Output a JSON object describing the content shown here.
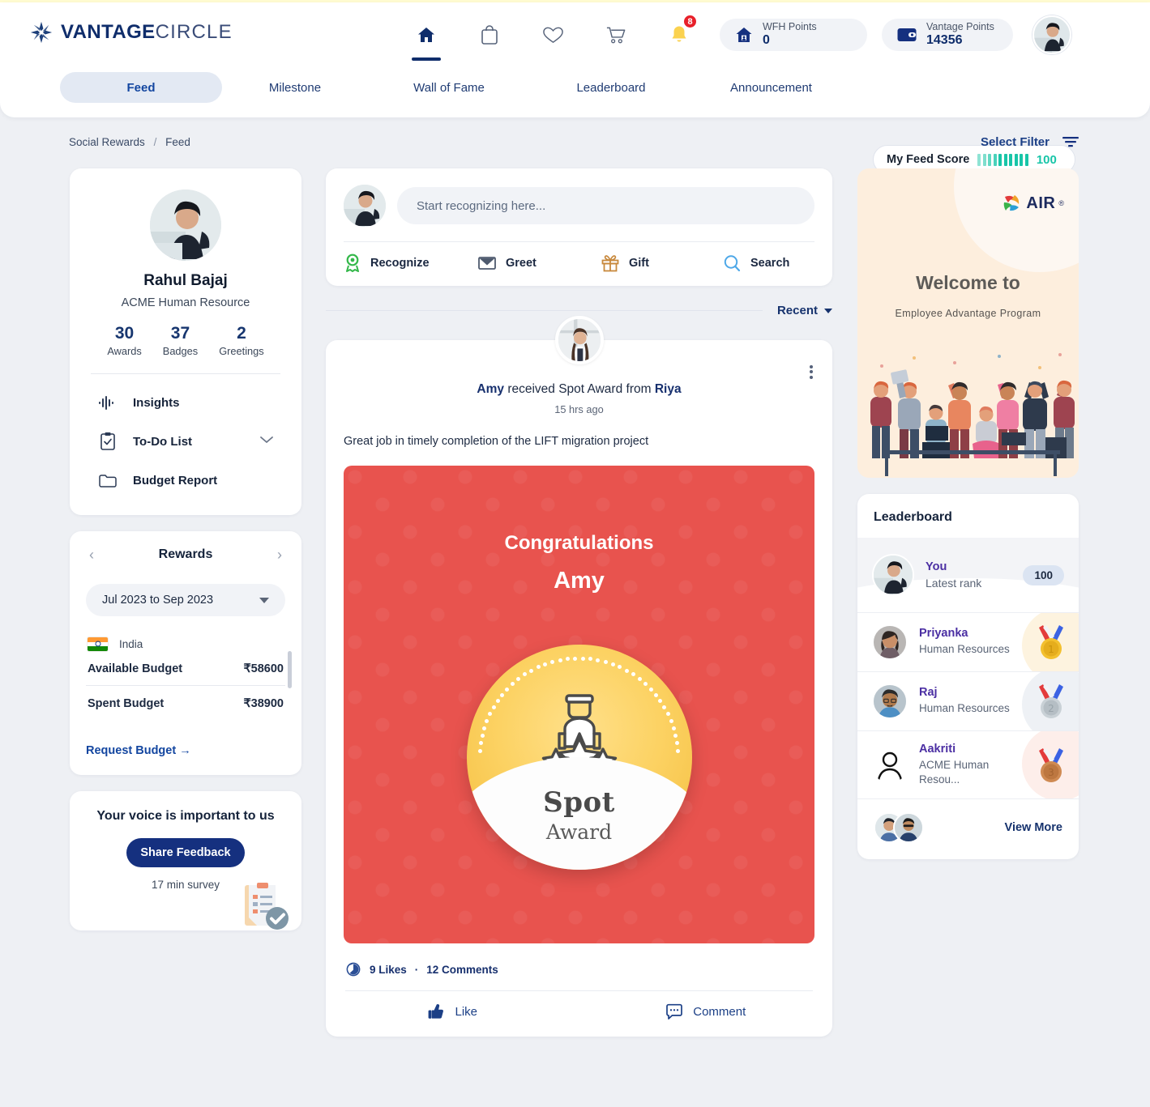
{
  "brand": {
    "name_bold": "VANTAGE",
    "name_light": "CIRCLE",
    "accent": "#0f2d6b"
  },
  "header": {
    "nav_icons": [
      {
        "name": "home-icon",
        "active": true
      },
      {
        "name": "shopping-bag-icon",
        "active": false
      },
      {
        "name": "heart-icon",
        "active": false
      },
      {
        "name": "cart-icon",
        "active": false
      },
      {
        "name": "bell-icon",
        "active": false,
        "badge": "8"
      }
    ],
    "wfh": {
      "label": "WFH Points",
      "value": "0",
      "icon": "home-points-icon"
    },
    "vantage": {
      "label": "Vantage Points",
      "value": "14356",
      "icon": "wallet-icon"
    },
    "avatar": "user-avatar"
  },
  "tabs": [
    {
      "label": "Feed",
      "active": true
    },
    {
      "label": "Milestone",
      "active": false
    },
    {
      "label": "Wall of Fame",
      "active": false
    },
    {
      "label": "Leaderboard",
      "active": false
    },
    {
      "label": "Announcement",
      "active": false
    }
  ],
  "feed_score": {
    "label": "My Feed Score",
    "value": "100",
    "bars": 10,
    "color": "#18c5a8"
  },
  "breadcrumb": {
    "root": "Social Rewards",
    "sep": "/",
    "current": "Feed"
  },
  "filter": {
    "label": "Select Filter",
    "icon": "filter-icon"
  },
  "profile": {
    "name": "Rahul Bajaj",
    "role": "ACME Human Resource",
    "stats": [
      {
        "value": "30",
        "label": "Awards"
      },
      {
        "value": "37",
        "label": "Badges"
      },
      {
        "value": "2",
        "label": "Greetings"
      }
    ],
    "links": [
      {
        "label": "Insights",
        "icon": "insights-icon",
        "chevron": false
      },
      {
        "label": "To-Do List",
        "icon": "todo-clipboard-icon",
        "chevron": true
      },
      {
        "label": "Budget Report",
        "icon": "folder-icon",
        "chevron": false
      }
    ]
  },
  "rewards": {
    "title": "Rewards",
    "prev": "‹",
    "next": "›",
    "period": "Jul 2023 to Sep 2023",
    "country": "India",
    "rows": [
      {
        "key": "Available Budget",
        "value": "₹58600"
      },
      {
        "key": "Spent Budget",
        "value": "₹38900"
      }
    ],
    "request_label": "Request Budget →"
  },
  "feedback": {
    "title": "Your voice is important to us",
    "button": "Share Feedback",
    "subtitle": "17 min survey",
    "illustration": "survey-clipboard-icon"
  },
  "composer": {
    "placeholder": "Start recognizing here...",
    "value": "",
    "actions": [
      {
        "label": "Recognize",
        "icon": "recognize-medal-icon",
        "color": "#35b84b"
      },
      {
        "label": "Greet",
        "icon": "envelope-icon",
        "color": "#4e5a6e"
      },
      {
        "label": "Gift",
        "icon": "gift-icon",
        "color": "#c8893d"
      },
      {
        "label": "Search",
        "icon": "search-icon",
        "color": "#4ea8e8"
      }
    ]
  },
  "sort": {
    "label": "Recent"
  },
  "post": {
    "actor": "Amy",
    "title_mid": " received Spot Award from ",
    "giver": "Riya",
    "time": "15 hrs ago",
    "message": "Great job in timely completion of the LIFT migration project",
    "card": {
      "congrats": "Congratulations",
      "name": "Amy",
      "badge_line1": "Spot",
      "badge_line2": "Award",
      "bg_color": "#e8534e"
    },
    "likes": "9 Likes",
    "dot": "·",
    "comments": "12 Comments",
    "like_btn": "Like",
    "comment_btn": "Comment"
  },
  "air_banner": {
    "logo_text": "AIR",
    "logo_sup": "®",
    "welcome": "Welcome to",
    "subtitle": "Employee  Advantage  Program"
  },
  "leaderboard": {
    "title": "Leaderboard",
    "you": {
      "name": "You",
      "rank_label": "Latest rank",
      "score": "100"
    },
    "rows": [
      {
        "name": "Priyanka",
        "org": "Human Resources",
        "medal": "gold-medal-icon",
        "medal_num": "1",
        "blob": "#fdf3df"
      },
      {
        "name": "Raj",
        "org": "Human Resources",
        "medal": "silver-medal-icon",
        "medal_num": "2",
        "blob": "#eef1f5"
      },
      {
        "name": "Aakriti",
        "org": "ACME Human Resou...",
        "medal": "bronze-medal-icon",
        "medal_num": "3",
        "blob": "#fdeeea"
      }
    ],
    "view_more": "View More"
  }
}
